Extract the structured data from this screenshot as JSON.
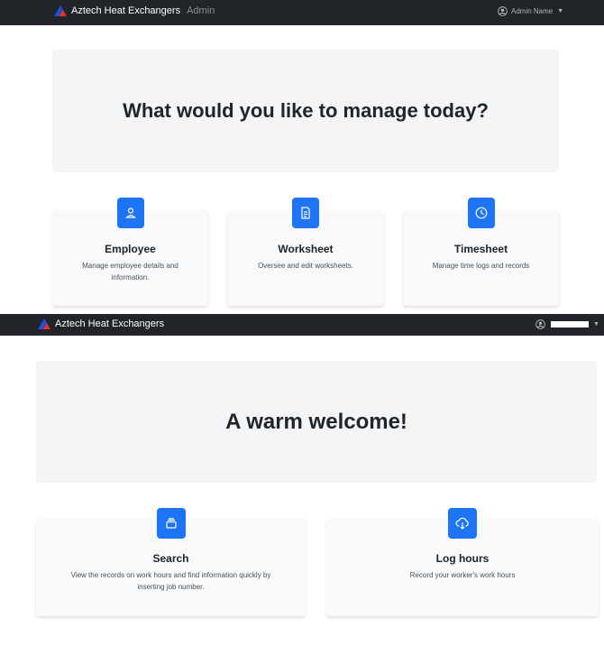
{
  "top": {
    "navbar": {
      "brand": "Aztech Heat Exchangers",
      "role": "Admin",
      "user_name": "Admin Name"
    },
    "hero": {
      "title": "What would you like to manage today?"
    },
    "cards": [
      {
        "icon": "user-icon",
        "title": "Employee",
        "text": "Manage employee details and information."
      },
      {
        "icon": "document-icon",
        "title": "Worksheet",
        "text": "Oversee and edit worksheets."
      },
      {
        "icon": "clock-icon",
        "title": "Timesheet",
        "text": "Manage time logs and records"
      }
    ]
  },
  "bottom": {
    "navbar": {
      "brand": "Aztech Heat Exchangers"
    },
    "hero": {
      "title": "A warm welcome!"
    },
    "cards": [
      {
        "icon": "layers-icon",
        "title": "Search",
        "text": "View the records on work hours and find information quickly by inserting job number."
      },
      {
        "icon": "cloud-download-icon",
        "title": "Log hours",
        "text": "Record your worker's work hours"
      }
    ]
  },
  "colors": {
    "navbar": "#212529",
    "accent": "#1d74f5",
    "hero_bg": "#f4f5f7",
    "card_bg": "#f8f9fa"
  }
}
